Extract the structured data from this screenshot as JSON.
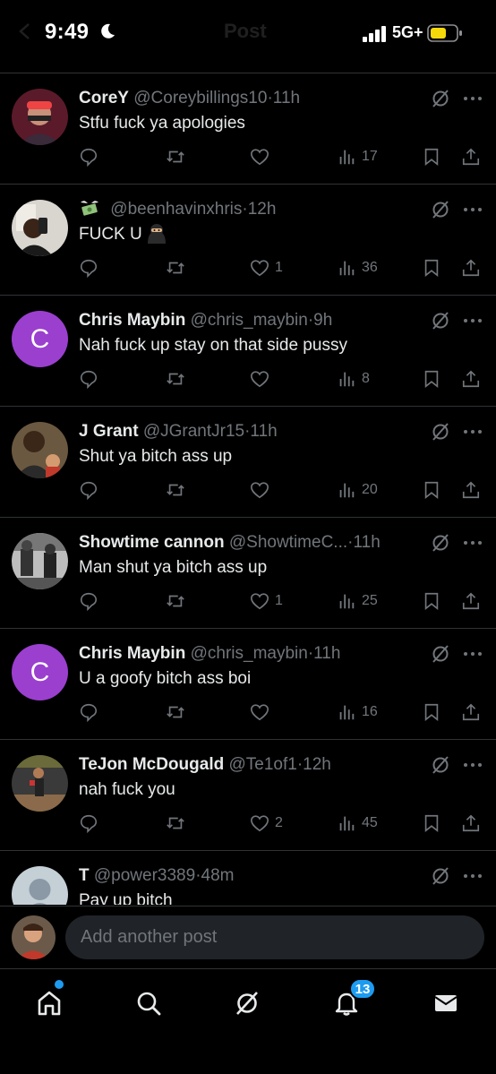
{
  "status_bar": {
    "time": "9:49",
    "network": "5G+",
    "battery_color": "#f5d90a"
  },
  "header": {
    "title": "Post"
  },
  "colors": {
    "background": "#000000",
    "text_primary": "#e7e9ea",
    "text_secondary": "#71767b",
    "divider": "#2f3336",
    "accent": "#1d9bf0",
    "letter_avatar": "#9b3fcf"
  },
  "posts": [
    {
      "display_name": "CoreY",
      "handle": "@Coreybillings10",
      "time": "11h",
      "text": "Stfu fuck ya apologies",
      "likes": "",
      "views": "17",
      "avatar": "photo"
    },
    {
      "display_name": "",
      "name_emoji": "money-with-wings-emoji",
      "handle": "@beenhavinxhris",
      "time": "12h",
      "text": "FUCK U",
      "text_emoji": "ninja-emoji",
      "likes": "1",
      "views": "36",
      "avatar": "photo"
    },
    {
      "display_name": "Chris Maybin",
      "handle": "@chris_maybin",
      "time": "9h",
      "text": "Nah fuck up stay on that side pussy",
      "likes": "",
      "views": "8",
      "avatar": "letter",
      "avatar_letter": "C"
    },
    {
      "display_name": "J Grant",
      "handle": "@JGrantJr15",
      "time": "11h",
      "text": "Shut ya bitch ass up",
      "likes": "",
      "views": "20",
      "avatar": "photo"
    },
    {
      "display_name": "Showtime cannon",
      "handle": "@ShowtimeC...",
      "time": "11h",
      "text": "Man shut ya bitch ass up",
      "likes": "1",
      "views": "25",
      "avatar": "photo"
    },
    {
      "display_name": "Chris Maybin",
      "handle": "@chris_maybin",
      "time": "11h",
      "text": "U a goofy bitch ass boi",
      "likes": "",
      "views": "16",
      "avatar": "letter",
      "avatar_letter": "C"
    },
    {
      "display_name": "TeJon McDougald",
      "handle": "@Te1of1",
      "time": "12h",
      "text": "nah fuck you",
      "likes": "2",
      "views": "45",
      "avatar": "photo"
    },
    {
      "display_name": "T",
      "handle": "@power3389",
      "time": "48m",
      "text": "Pay up bitch",
      "likes": "",
      "views": "",
      "avatar": "default"
    }
  ],
  "reply_bar": {
    "placeholder": "Add another post"
  },
  "tab_bar": {
    "items": [
      "home-icon",
      "search-icon",
      "grok-icon",
      "notifications-icon",
      "messages-icon"
    ],
    "notifications_badge": "13"
  }
}
